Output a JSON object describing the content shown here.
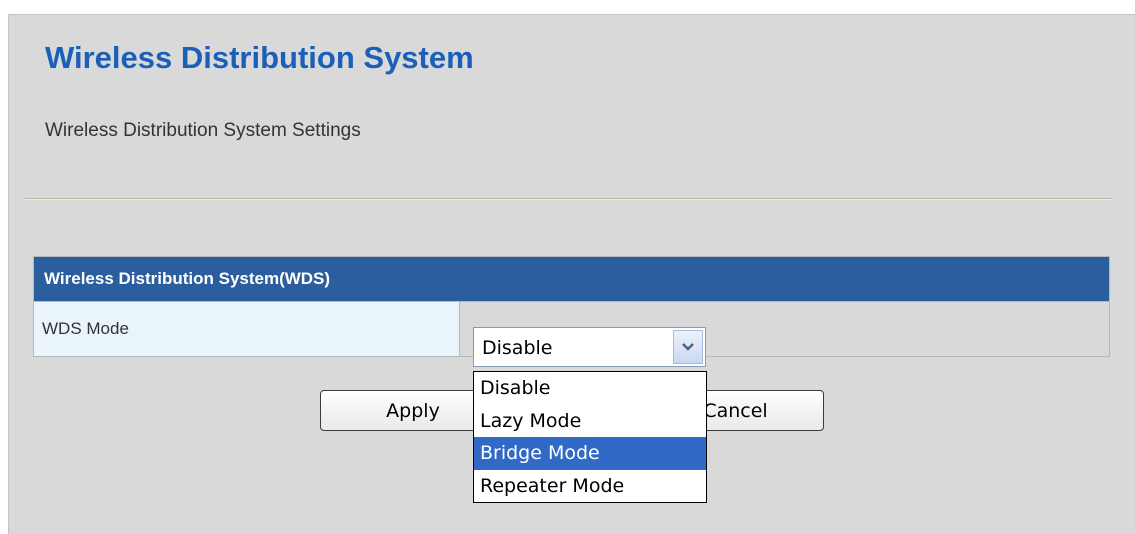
{
  "page": {
    "title": "Wireless Distribution System",
    "subtitle": "Wireless Distribution System Settings"
  },
  "wds_table": {
    "header": "Wireless Distribution System(WDS)",
    "rows": [
      {
        "label": "WDS Mode",
        "value": "Disable"
      }
    ]
  },
  "wds_mode_select": {
    "current_value": "Disable",
    "options": [
      "Disable",
      "Lazy Mode",
      "Bridge Mode",
      "Repeater Mode"
    ],
    "highlighted": "Bridge Mode",
    "is_open": true
  },
  "buttons": {
    "apply_label": "Apply",
    "cancel_label": "Cancel"
  },
  "colors": {
    "title": "#1a5fb8",
    "table_header_bg": "#2b5e9f",
    "label_cell_bg": "#eaf4fb",
    "page_bg": "#d9d9d9",
    "highlight": "#3169c6"
  },
  "icons": {
    "select_arrow": "chevron-down-icon"
  }
}
